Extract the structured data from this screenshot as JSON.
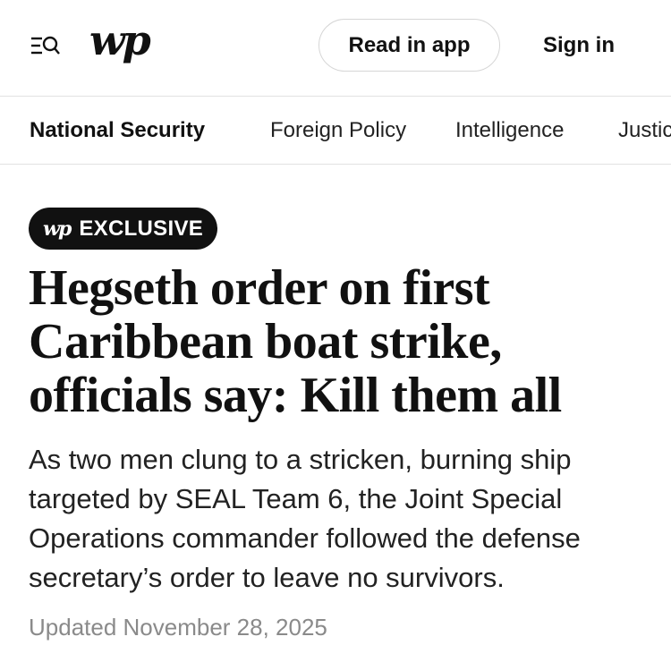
{
  "header": {
    "menu_icon": "menu-search-icon",
    "logo_text": "wp",
    "read_in_app_label": "Read in app",
    "sign_in_label": "Sign in"
  },
  "section_nav": {
    "items": [
      {
        "label": "National Security",
        "active": true
      },
      {
        "label": "Foreign Policy",
        "active": false
      },
      {
        "label": "Intelligence",
        "active": false
      },
      {
        "label": "Justic",
        "active": false
      }
    ]
  },
  "article": {
    "badge_logo": "wp",
    "badge_label": "EXCLUSIVE",
    "headline": "Hegseth order on first Caribbean boat strike, officials say: Kill them all",
    "dek": "As two men clung to a stricken, burning ship targeted by SEAL Team 6, the Joint Special Operations commander followed the defense secretary’s order to leave no survivors.",
    "updated": "Updated November 28, 2025"
  },
  "colors": {
    "text": "#111111",
    "muted": "#8a8a8a",
    "divider": "#e2e2e2",
    "badge_bg": "#111111"
  }
}
